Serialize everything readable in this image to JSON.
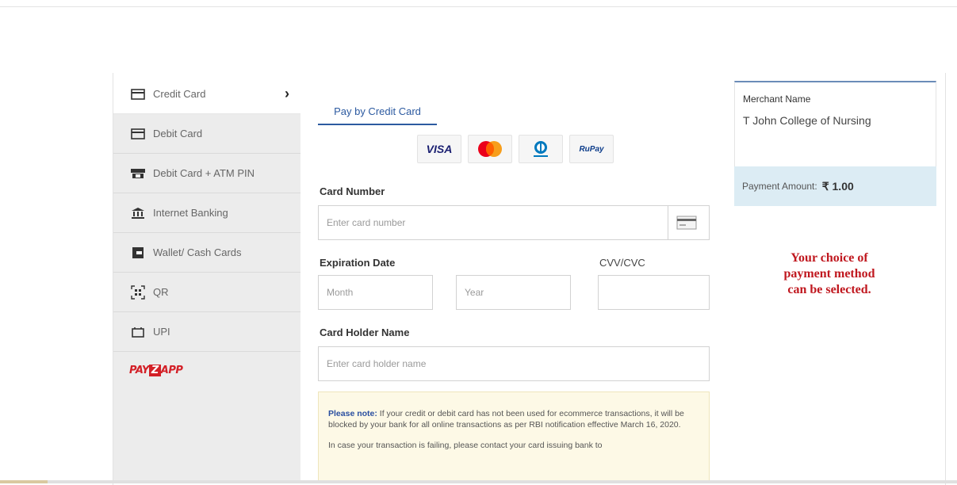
{
  "sidebar": {
    "items": [
      {
        "label": "Credit Card",
        "icon": "credit-card-icon"
      },
      {
        "label": "Debit Card",
        "icon": "debit-card-icon"
      },
      {
        "label": "Debit Card + ATM PIN",
        "icon": "atm-pin-icon"
      },
      {
        "label": "Internet Banking",
        "icon": "bank-icon"
      },
      {
        "label": "Wallet/ Cash Cards",
        "icon": "wallet-icon"
      },
      {
        "label": "QR",
        "icon": "qr-icon"
      },
      {
        "label": "UPI",
        "icon": "upi-icon"
      }
    ],
    "payzapp": {
      "pre": "PAY",
      "z": "Z",
      "post": "APP"
    }
  },
  "form": {
    "tab_label": "Pay by Credit Card",
    "card_brands": {
      "visa": "VISA",
      "rupay": "RuPay"
    },
    "card_number_label": "Card Number",
    "card_number_placeholder": "Enter card number",
    "expiration_label": "Expiration Date",
    "cvv_label": "CVV/CVC",
    "month_placeholder": "Month",
    "year_placeholder": "Year",
    "holder_label": "Card Holder Name",
    "holder_placeholder": "Enter card holder name",
    "note_heading": "Please note:",
    "note_text": " If your credit or debit card has not been used for ecommerce transactions, it will be blocked by your bank for all online transactions as per RBI notification effective March 16, 2020.",
    "note_text2": "In case your transaction is failing, please contact your card issuing bank to"
  },
  "summary": {
    "merchant_heading": "Merchant Name",
    "merchant_name": "T John College of Nursing",
    "amount_label": "Payment Amount:",
    "amount_value": "₹ 1.00"
  },
  "annotation": {
    "line1": "Your choice of",
    "line2": "payment method",
    "line3": "can be selected."
  },
  "colors": {
    "accent": "#2c5aa0",
    "annotation": "#c0181f",
    "amount_bg": "#dcecf4",
    "sidebar_bg": "#ececec"
  }
}
